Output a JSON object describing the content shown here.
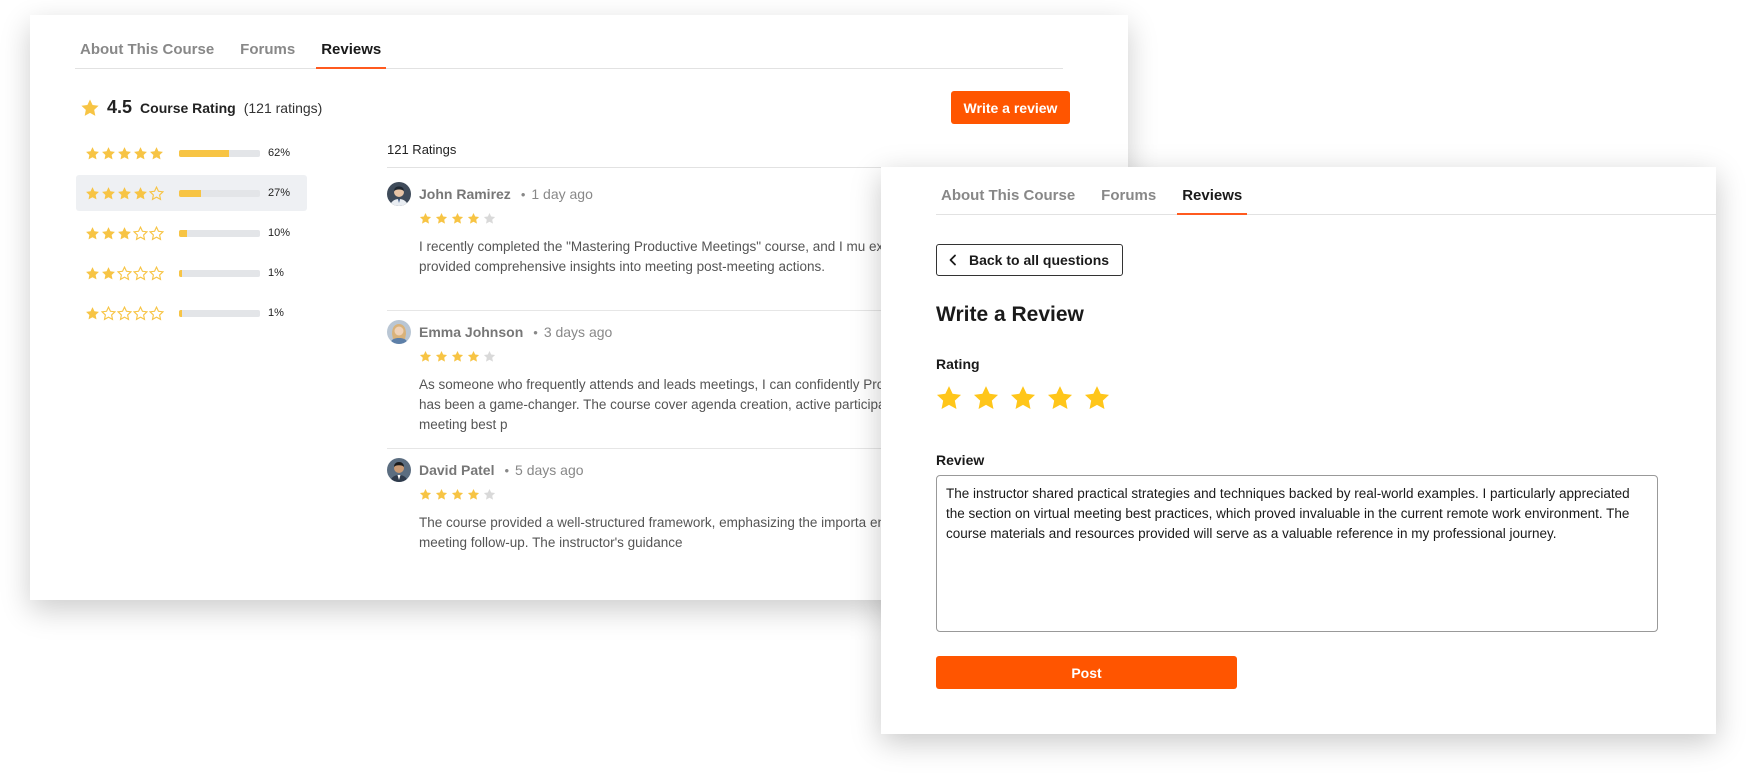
{
  "colors": {
    "accent": "#ff5500",
    "star": "#f7c444",
    "star_empty": "#d9d9d9"
  },
  "tabs": [
    {
      "label": "About This Course",
      "active": false
    },
    {
      "label": "Forums",
      "active": false
    },
    {
      "label": "Reviews",
      "active": true
    }
  ],
  "summary": {
    "rating_value": "4.5",
    "rating_label": "Course Rating",
    "ratings_count": "(121 ratings)",
    "write_review_label": "Write a review"
  },
  "distribution": [
    {
      "stars": 5,
      "fraction": 0.62,
      "percent": "62%"
    },
    {
      "stars": 4,
      "fraction": 0.27,
      "percent": "27%"
    },
    {
      "stars": 3,
      "fraction": 0.1,
      "percent": "10%"
    },
    {
      "stars": 2,
      "fraction": 0.01,
      "percent": "1%"
    },
    {
      "stars": 1,
      "fraction": 0.01,
      "percent": "1%"
    }
  ],
  "reviews_list": {
    "title": "121 Ratings",
    "items": [
      {
        "name": "John Ramirez",
        "age": "1 day ago",
        "stars": 4,
        "text": "I recently completed the \"Mastering Productive Meetings\" course, and I mu expectations. The instructor provided comprehensive insights into meeting post-meeting actions."
      },
      {
        "name": "Emma Johnson",
        "age": "3 days ago",
        "stars": 4,
        "text": "As someone who frequently attends and leads meetings, I can confidently Productive Meetings\" course has been a game-changer. The course cover agenda creation, active participation techniques, and virtual meeting best p"
      },
      {
        "name": "David Patel",
        "age": "5 days ago",
        "stars": 4,
        "text": "The course provided a well-structured framework, emphasizing the importa engaging facilitation, and post-meeting follow-up. The instructor's guidance"
      }
    ]
  },
  "form": {
    "back_label": "Back to all questions",
    "title": "Write a Review",
    "rating_label": "Rating",
    "rating_value": 5,
    "review_label": "Review",
    "review_text": "The instructor shared practical strategies and techniques backed by real-world examples. I particularly appreciated the section on virtual meeting best practices, which proved invaluable in the current remote work environment. The course materials and resources provided will serve as a valuable reference in my professional journey.",
    "post_label": "Post"
  }
}
